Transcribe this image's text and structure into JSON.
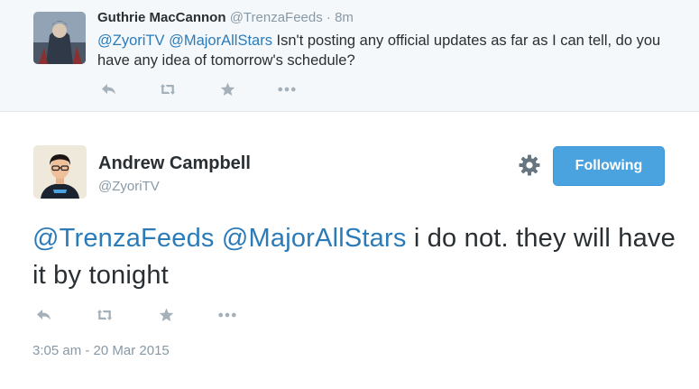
{
  "parent_tweet": {
    "author_name": "Guthrie MacCannon",
    "author_handle": "@TrenzaFeeds",
    "separator": "·",
    "time": "8m",
    "mention_1": "@ZyoriTV",
    "mention_2": "@MajorAllStars",
    "text": "Isn't posting any official updates as far as I can tell, do you have any idea of tomorrow's schedule?",
    "actions": [
      "reply-icon",
      "retweet-icon",
      "favorite-icon",
      "more-icon"
    ]
  },
  "main_tweet": {
    "author_name": "Andrew Campbell",
    "author_handle": "@ZyoriTV",
    "follow_label": "Following",
    "mention_1": "@TrenzaFeeds",
    "mention_2": "@MajorAllStars",
    "text": "i do not. they will have it by tonight",
    "timestamp": "3:05 am - 20 Mar 2015",
    "actions": [
      "reply-icon",
      "retweet-icon",
      "favorite-icon",
      "more-icon"
    ]
  },
  "colors": {
    "link": "#2b7bb9",
    "follow_button": "#4aa3df",
    "muted_text": "#8899a6",
    "icon": "#a4b0ba",
    "parent_background": "#f5f8fa"
  }
}
